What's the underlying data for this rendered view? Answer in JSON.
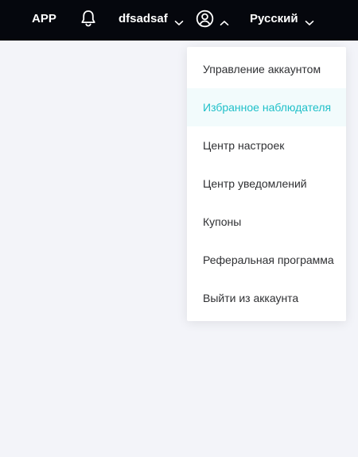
{
  "topbar": {
    "app_label": "APP",
    "username": "dfsadsaf",
    "language": "Русский"
  },
  "dropdown": {
    "items": [
      {
        "label": "Управление аккаунтом"
      },
      {
        "label": "Избранное наблюдателя"
      },
      {
        "label": "Центр настроек"
      },
      {
        "label": "Центр уведомлений"
      },
      {
        "label": "Купоны"
      },
      {
        "label": "Реферальная программа"
      },
      {
        "label": "Выйти из аккаунта"
      }
    ],
    "active_index": 1
  },
  "colors": {
    "topbar_bg": "#05070d",
    "page_bg": "#f3f4f9",
    "accent": "#1fc0c9",
    "active_item_bg": "#f2fbfc",
    "menu_text": "#2f3033"
  },
  "icons": {
    "notifications": "bell-icon",
    "user_menu_caret": "chevron-down-icon",
    "account": "user-circle-icon",
    "account_caret": "chevron-up-icon",
    "language_caret": "chevron-down-icon"
  }
}
